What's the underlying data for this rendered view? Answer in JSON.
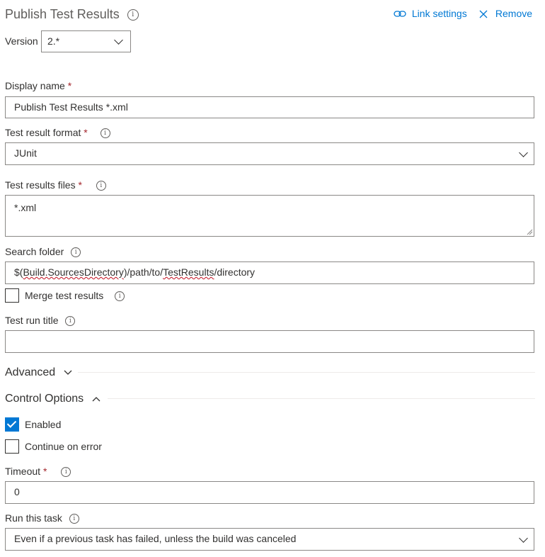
{
  "header": {
    "title": "Publish Test Results",
    "link_settings": "Link settings",
    "remove": "Remove"
  },
  "version": {
    "label": "Version",
    "value": "2.*"
  },
  "display_name": {
    "label": "Display name",
    "value": "Publish Test Results *.xml"
  },
  "test_result_format": {
    "label": "Test result format",
    "value": "JUnit"
  },
  "test_results_files": {
    "label": "Test results files",
    "value": "*.xml"
  },
  "search_folder": {
    "label": "Search folder",
    "value_prefix": "$(",
    "value_part1": "Build.SourcesDirectory",
    "value_mid": ")/path/to/",
    "value_part2": "TestResults",
    "value_suffix": "/directory"
  },
  "merge_test_results": {
    "label": "Merge test results",
    "checked": false
  },
  "test_run_title": {
    "label": "Test run title",
    "value": ""
  },
  "advanced": {
    "label": "Advanced"
  },
  "control_options": {
    "label": "Control Options"
  },
  "enabled": {
    "label": "Enabled",
    "checked": true
  },
  "continue_on_error": {
    "label": "Continue on error",
    "checked": false
  },
  "timeout": {
    "label": "Timeout",
    "value": "0"
  },
  "run_this_task": {
    "label": "Run this task",
    "value": "Even if a previous task has failed, unless the build was canceled"
  },
  "required_marker": "*",
  "colors": {
    "accent": "#0078d4",
    "required": "#a4262c"
  }
}
